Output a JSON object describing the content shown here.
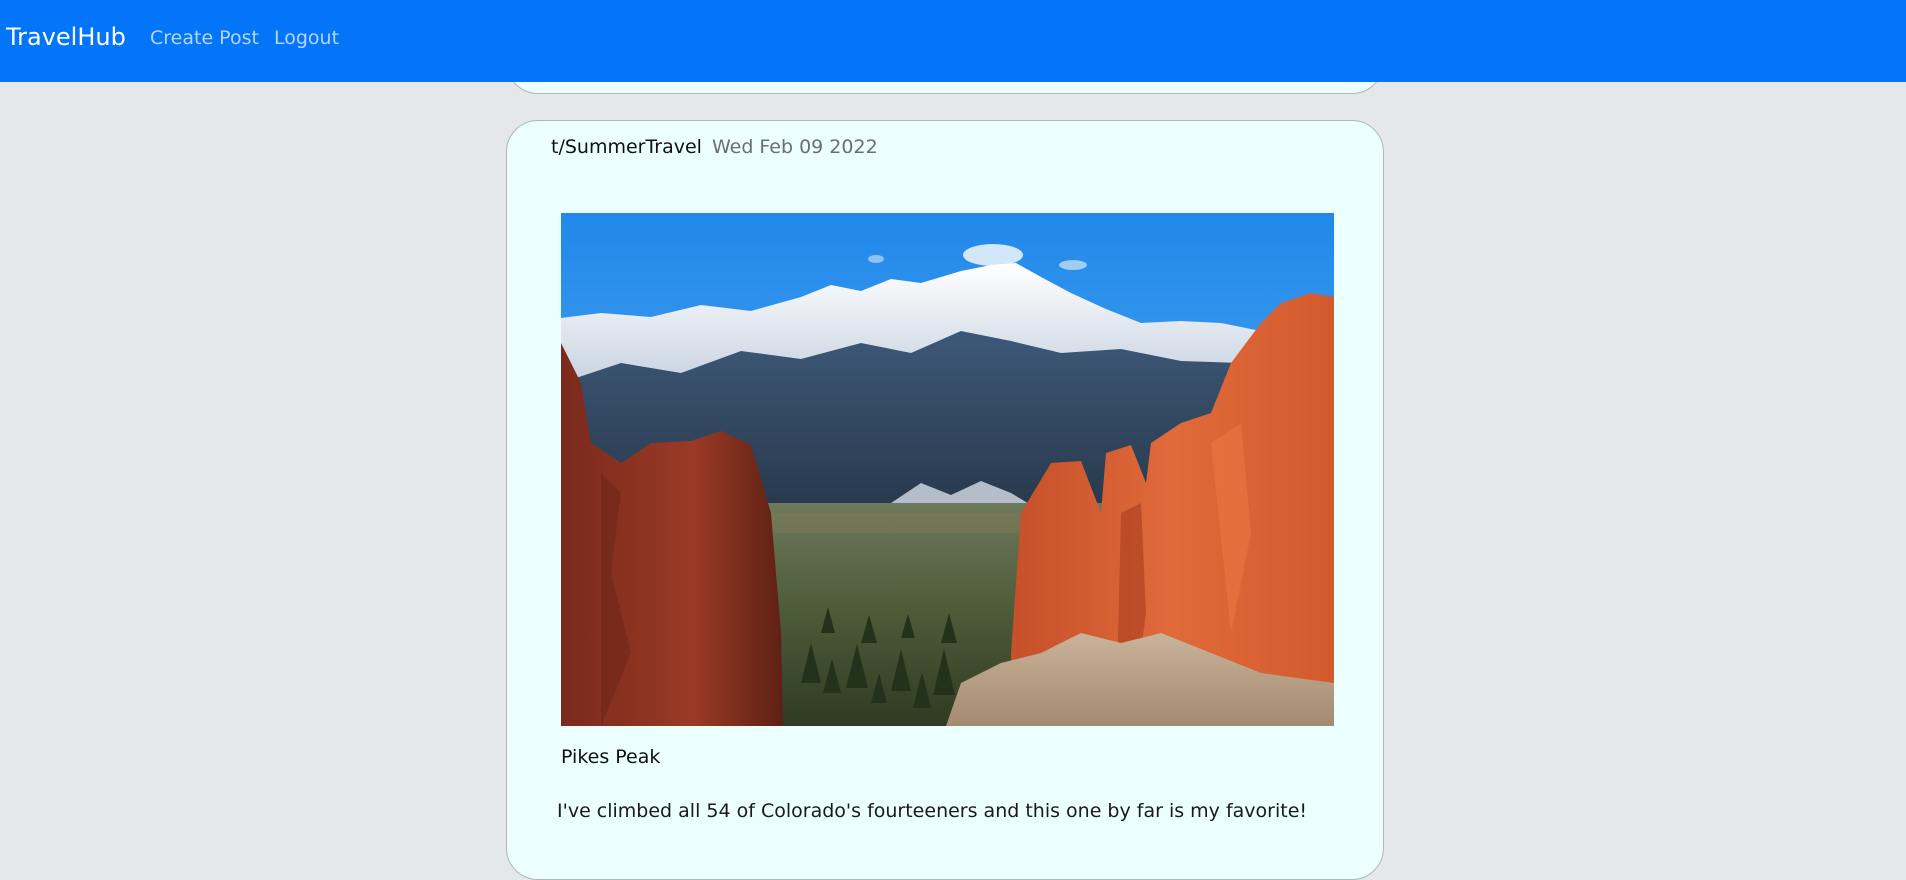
{
  "navbar": {
    "brand": "TravelHub",
    "links": [
      {
        "label": "Create Post"
      },
      {
        "label": "Logout"
      }
    ],
    "background_color": "#0275f8"
  },
  "post": {
    "community": "t/SummerTravel",
    "date": "Wed Feb 09 2022",
    "image_caption": "Pikes Peak",
    "body": "I've climbed all 54 of Colorado's fourteeners and this one by far is my favorite!",
    "card_color": "#ebfffe"
  }
}
